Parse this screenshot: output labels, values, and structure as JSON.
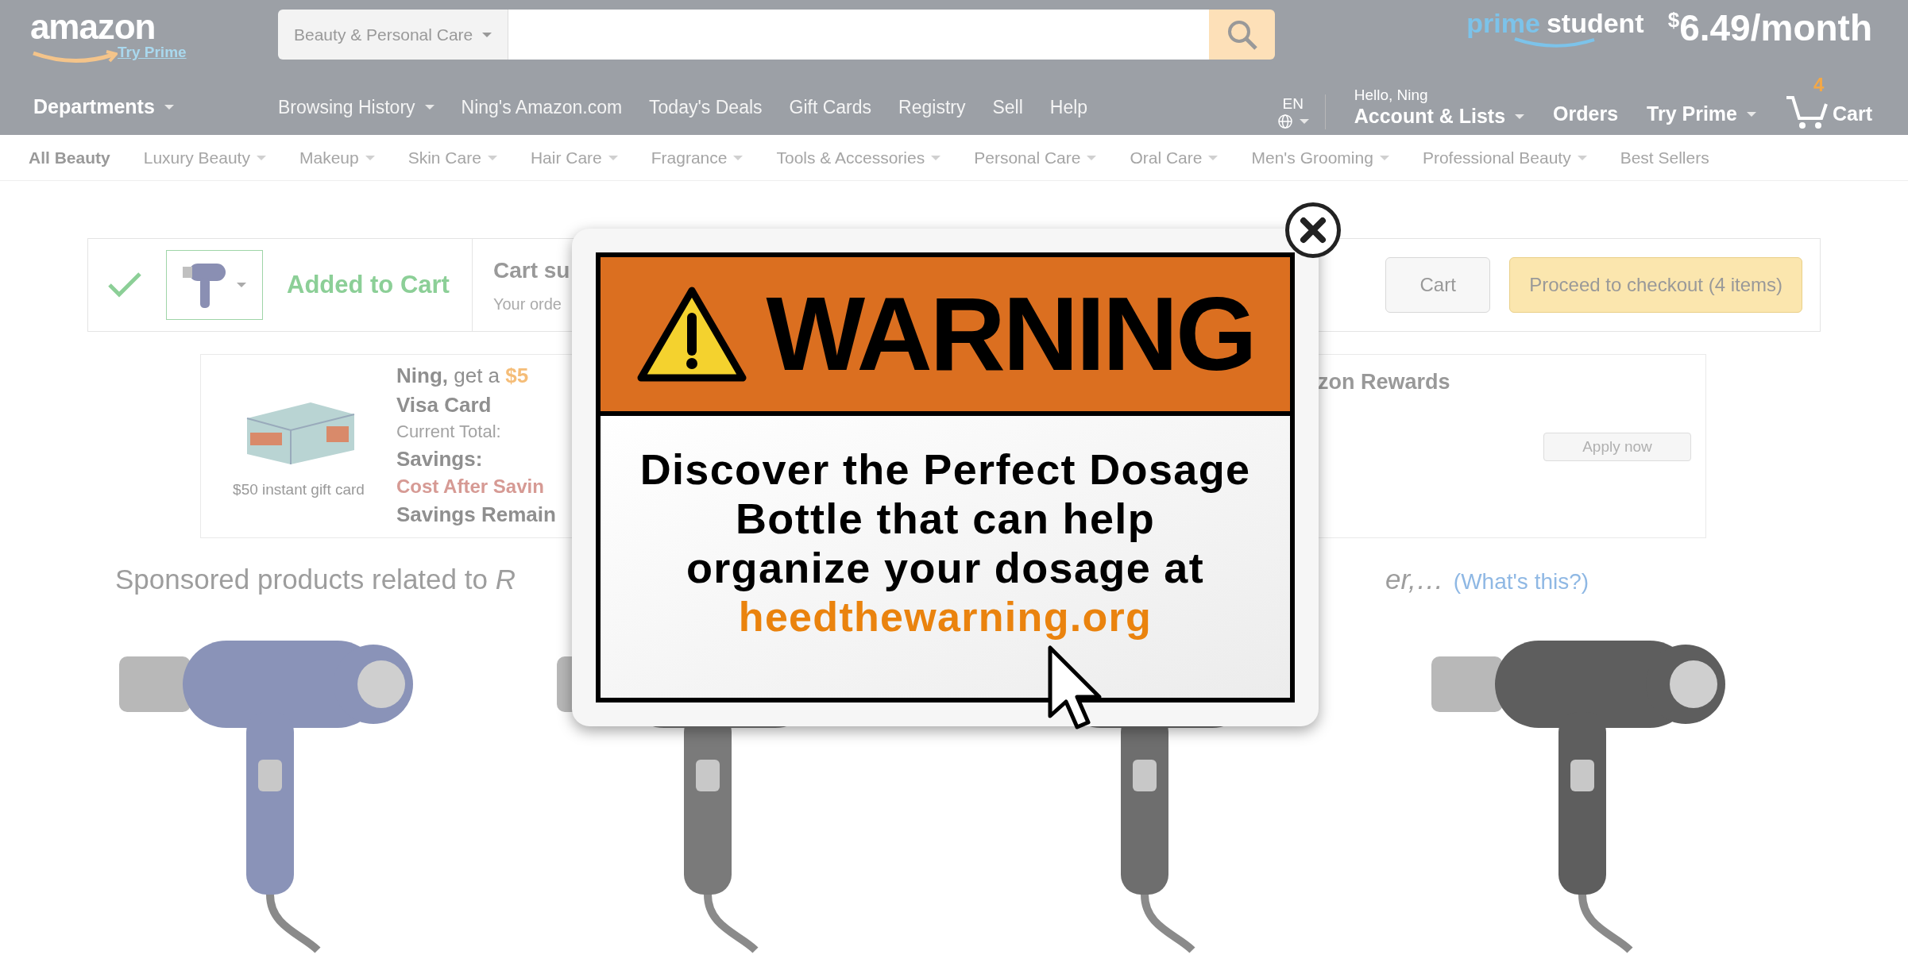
{
  "header": {
    "logo": "amazon",
    "logo_link": "Try Prime",
    "search": {
      "category": "Beauty & Personal Care"
    },
    "promo_brand": [
      "prime",
      "student"
    ],
    "promo_currency": "$",
    "promo_price": "6.49/month"
  },
  "nav": {
    "departments": "Departments",
    "links": [
      {
        "label": "Browsing History",
        "has_menu": true
      },
      {
        "label": "Ning's Amazon.com",
        "has_menu": false
      },
      {
        "label": "Today's Deals",
        "has_menu": false
      },
      {
        "label": "Gift Cards",
        "has_menu": false
      },
      {
        "label": "Registry",
        "has_menu": false
      },
      {
        "label": "Sell",
        "has_menu": false
      },
      {
        "label": "Help",
        "has_menu": false
      }
    ],
    "language": "EN",
    "greeting": "Hello, Ning",
    "account": "Account & Lists",
    "orders": "Orders",
    "try_prime": "Try Prime",
    "cart_count": "4",
    "cart": "Cart"
  },
  "subnav": [
    {
      "label": "All Beauty",
      "selected": true,
      "has_menu": false
    },
    {
      "label": "Luxury Beauty",
      "selected": false,
      "has_menu": true
    },
    {
      "label": "Makeup",
      "selected": false,
      "has_menu": true
    },
    {
      "label": "Skin Care",
      "selected": false,
      "has_menu": true
    },
    {
      "label": "Hair Care",
      "selected": false,
      "has_menu": true
    },
    {
      "label": "Fragrance",
      "selected": false,
      "has_menu": true
    },
    {
      "label": "Tools & Accessories",
      "selected": false,
      "has_menu": true
    },
    {
      "label": "Personal Care",
      "selected": false,
      "has_menu": true
    },
    {
      "label": "Oral Care",
      "selected": false,
      "has_menu": true
    },
    {
      "label": "Men's Grooming",
      "selected": false,
      "has_menu": true
    },
    {
      "label": "Professional Beauty",
      "selected": false,
      "has_menu": true
    },
    {
      "label": "Best Sellers",
      "selected": false,
      "has_menu": false
    }
  ],
  "cart_bar": {
    "status": "Added to Cart",
    "summary_title": "Cart su",
    "summary_text": "Your orde",
    "buttons": [
      {
        "label": "Cart",
        "kind": "secondary"
      },
      {
        "label": "Proceed to checkout (4 items)",
        "kind": "primary"
      }
    ]
  },
  "offer": {
    "image_caption": "$50 instant gift card",
    "lines": [
      {
        "text": "**Ning,** get a",
        "highlight": "$5",
        "kind": "headline"
      },
      {
        "text": "Visa Card",
        "kind": "bold"
      },
      {
        "text": "Current Total:",
        "kind": "plain"
      },
      {
        "text": "Savings:",
        "kind": "bold"
      },
      {
        "text": "Cost After Savin",
        "kind": "alert"
      },
      {
        "text": "Savings Remain",
        "kind": "bold"
      }
    ],
    "right_title": "zon Rewards",
    "apply": "Apply now"
  },
  "sponsored": {
    "text": "Sponsored products related to *R*",
    "text_end": "er,…",
    "link": "(What's this?)"
  },
  "popup": {
    "heading": "WARNING",
    "body": [
      "Discover the Perfect Dosage",
      "Bottle that can help",
      "organize your dosage at"
    ],
    "link": "heedthewarning.org"
  }
}
